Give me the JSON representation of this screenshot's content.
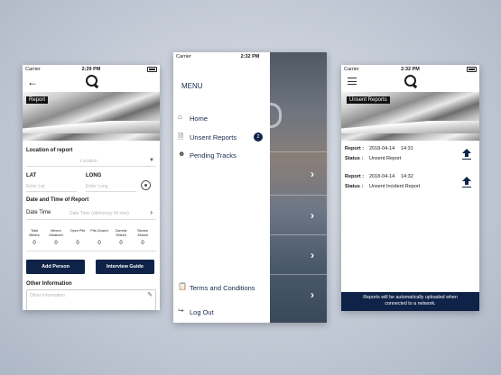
{
  "screens": {
    "report": {
      "status": {
        "carrier": "Carrier",
        "time": "2:29 PM"
      },
      "tag": "Report",
      "location_label": "Location of report",
      "location_placeholder": "Location",
      "lat_label": "LAT",
      "long_label": "LONG",
      "lat_placeholder": "Enter Lat",
      "long_placeholder": "Enter Long",
      "datetime_heading": "Date and Time of Report",
      "date_label": "Date Time",
      "date_placeholder": "Date Time (dd/mm/yy hh:mm)",
      "counters": [
        {
          "label": "Total Miners",
          "value": "0"
        },
        {
          "label": "Miners Detained",
          "value": "0"
        },
        {
          "label": "Open Pits",
          "value": "0"
        },
        {
          "label": "Pits Closed",
          "value": "0"
        },
        {
          "label": "Camels Seized",
          "value": "0"
        },
        {
          "label": "Stones Seized",
          "value": "0"
        }
      ],
      "add_person": "Add Person",
      "interview_guide": "Interview Guide",
      "other_label": "Other Information",
      "other_placeholder": "Other Information"
    },
    "menu": {
      "status": {
        "carrier": "Carrier",
        "time": "2:32 PM"
      },
      "title": "MENU",
      "items": [
        {
          "label": "Home"
        },
        {
          "label": "Unsent Reports",
          "badge": "2"
        },
        {
          "label": "Pending Tracks"
        }
      ],
      "terms": "Terms and Conditions",
      "logout": "Log Out"
    },
    "unsent": {
      "status": {
        "carrier": "Carrier",
        "time": "2:32 PM"
      },
      "tag": "Unsent Reports",
      "report_label": "Report :",
      "status_label": "Status :",
      "reports": [
        {
          "date": "2018-04-14",
          "time": "14:31",
          "status": "Unsent Report"
        },
        {
          "date": "2018-04-14",
          "time": "14:32",
          "status": "Unsent Incident Report"
        }
      ],
      "footer": "Reports will be automatically uploaded when connected to a network."
    }
  }
}
